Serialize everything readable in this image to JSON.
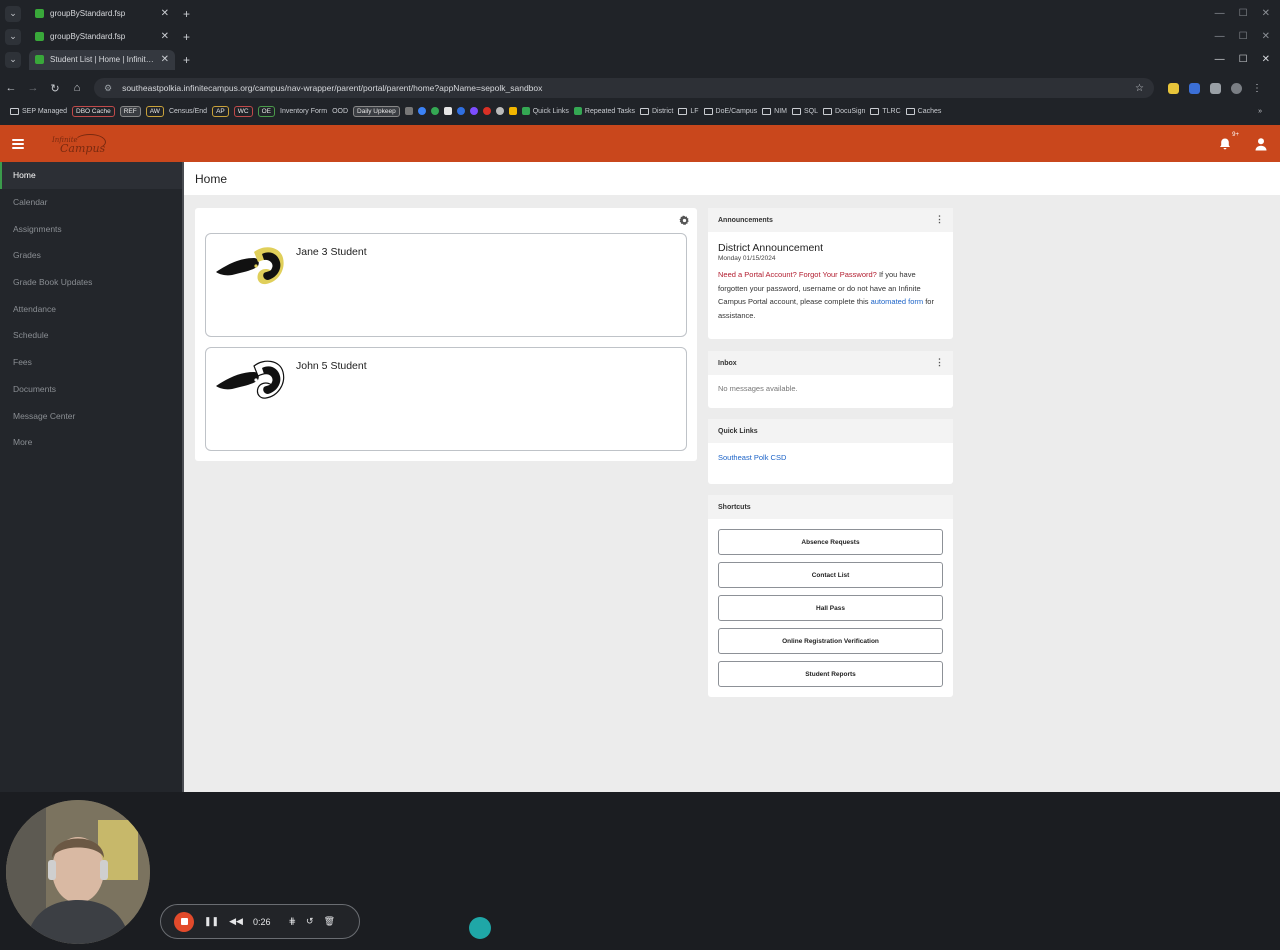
{
  "browser": {
    "tab_rows": [
      {
        "title": "groupByStandard.fsp"
      },
      {
        "title": "groupByStandard.fsp"
      },
      {
        "title": "Student List | Home | Infinite Ca"
      }
    ],
    "url": "southeastpolkia.infinitecampus.org/campus/nav-wrapper/parent/portal/parent/home?appName=sepolk_sandbox",
    "bookmarks": {
      "sep_managed": "SEP Managed",
      "dbo_cache": "DBO Cache",
      "ref": "REF",
      "aw": "AW",
      "census_end": "Census/End",
      "ap": "AP",
      "wc": "WC",
      "oe": "OE",
      "inventory_form": "Inventory Form",
      "ood": "OOD",
      "daily_upkeep": "Daily Upkeep",
      "quick_links": "Quick Links",
      "repeated_tasks": "Repeated Tasks",
      "district": "District",
      "lf": "LF",
      "doe_campus": "DoE/Campus",
      "nim": "NIM",
      "sql": "SQL",
      "docusign": "DocuSign",
      "tlrc": "TLRC",
      "caches": "Caches"
    }
  },
  "app": {
    "logo_line1": "Infinite",
    "logo_line2": "Campus",
    "notification_badge": "9+"
  },
  "sidebar": {
    "items": [
      {
        "label": "Home"
      },
      {
        "label": "Calendar"
      },
      {
        "label": "Assignments"
      },
      {
        "label": "Grades"
      },
      {
        "label": "Grade Book Updates"
      },
      {
        "label": "Attendance"
      },
      {
        "label": "Schedule"
      },
      {
        "label": "Fees"
      },
      {
        "label": "Documents"
      },
      {
        "label": "Message Center"
      },
      {
        "label": "More"
      }
    ]
  },
  "main": {
    "page_title": "Home",
    "students": [
      {
        "name": "Jane 3 Student"
      },
      {
        "name": "John 5 Student"
      }
    ],
    "announcements": {
      "header": "Announcements",
      "title": "District Announcement",
      "date": "Monday 01/15/2024",
      "red_text": "Need a Portal Account? Forgot Your Password?",
      "text1": " If you have forgotten your password, username or do not have an Infinite Campus Portal account, please complete this ",
      "link_text": "automated form",
      "text2": " for assistance."
    },
    "inbox": {
      "header": "Inbox",
      "empty": "No messages available."
    },
    "quick_links": {
      "header": "Quick Links",
      "link": "Southeast Polk CSD"
    },
    "shortcuts": {
      "header": "Shortcuts",
      "buttons": [
        {
          "label": "Absence Requests"
        },
        {
          "label": "Contact List"
        },
        {
          "label": "Hall Pass"
        },
        {
          "label": "Online Registration Verification"
        },
        {
          "label": "Student Reports"
        }
      ]
    }
  },
  "recorder": {
    "time": "0:26"
  },
  "colors": {
    "header_orange": "#c9471c",
    "sidebar_bg": "#23262b",
    "active_indicator": "#3b9b4b",
    "link_blue": "#1c63c7",
    "alert_red": "#b21d2f",
    "record_red": "#e24a2b",
    "cursor_teal": "#1fa7a7"
  }
}
